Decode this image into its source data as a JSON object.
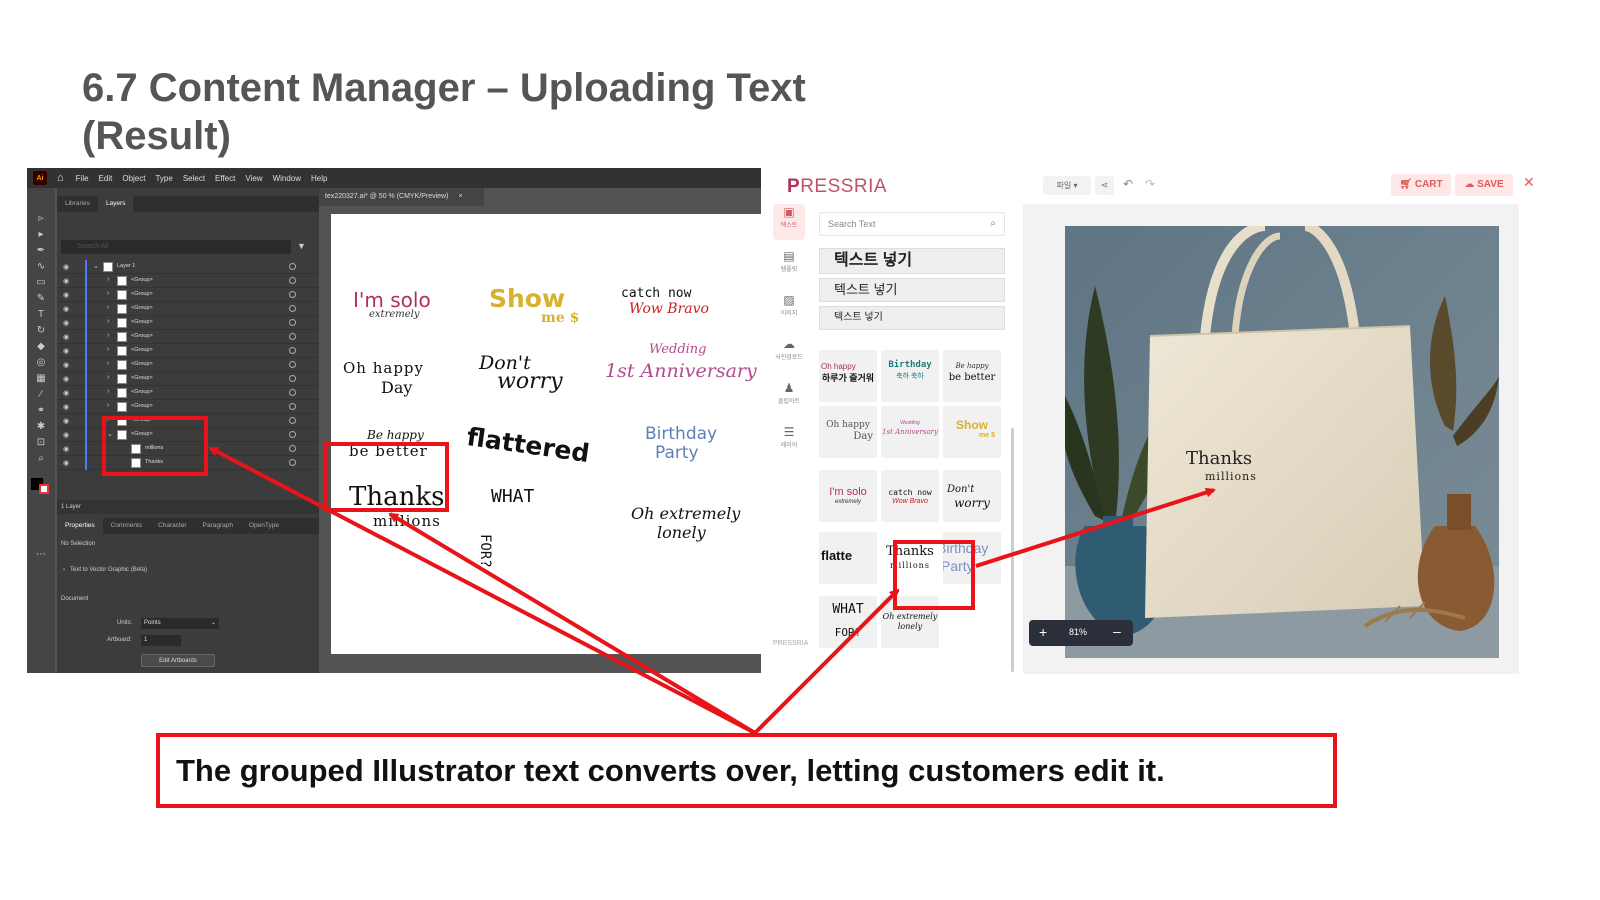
{
  "slide_title": "6.7 Content Manager – Uploading Text (Result)",
  "caption": "The grouped Illustrator text converts over, letting customers edit it.",
  "illustrator": {
    "app_icon": "Ai",
    "menu": [
      "File",
      "Edit",
      "Object",
      "Type",
      "Select",
      "Effect",
      "View",
      "Window",
      "Help"
    ],
    "panel_tabs": [
      "Libraries",
      "Layers"
    ],
    "search_placeholder": "Search All",
    "layers": {
      "top": "Layer 1",
      "group_label": "<Group>",
      "children": [
        "millions",
        "Thanks"
      ]
    },
    "layer_count": "1 Layer",
    "properties_tabs": [
      "Properties",
      "Comments",
      "Character",
      "Paragraph",
      "OpenType"
    ],
    "no_selection": "No Selection",
    "text_to_vector": "Text to Vector Graphic (Beta)",
    "document_label": "Document",
    "units_label": "Units:",
    "units_value": "Points",
    "artboard_label": "Artboard:",
    "artboard_value": "1",
    "edit_artboards": "Edit Artboards",
    "doc_tab": "tex220327.ai* @ 50 % (CMYK/Preview)",
    "artboard_items": {
      "i_m_solo": "I'm solo",
      "extremely": "extremely",
      "show": "Show",
      "me": "me $",
      "catch_now": "catch now",
      "wow_bravo": "Wow Bravo",
      "oh_happy": "Oh happy",
      "day": "Day",
      "dont": "Don't",
      "worry": "worry",
      "wedding": "Wedding",
      "anniversary": "1st Anniversary",
      "be_happy": "Be happy",
      "be_better": "be better",
      "flattered": "flattered",
      "birthday": "Birthday",
      "party": "Party",
      "thanks": "Thanks",
      "millions": "millions",
      "what": "WHAT",
      "for": "FOR?",
      "oh_extremely": "Oh extremely",
      "lonely": "lonely"
    }
  },
  "pressria": {
    "logo_p": "P",
    "logo_rest": "RESSRIA",
    "file_menu": "파일 ▾",
    "cart": "CART",
    "save": "SAVE",
    "rail": [
      "텍스트",
      "템플릿",
      "이미지",
      "사진업로드",
      "클립아트",
      "레이어"
    ],
    "brand_footer": "PRESSRIA",
    "search_placeholder": "Search Text",
    "text_buttons": [
      "텍스트 넣기",
      "텍스트 넣기",
      "텍스트 넣기"
    ],
    "tiles": {
      "t1a": "Oh happy",
      "t1b": "하루가 즐거워",
      "t2a": "Birthday",
      "t2b": "축하 축하",
      "t3a": "Be happy",
      "t3b": "be better",
      "t4a": "Oh happy",
      "t4b": "Day",
      "t5a": "Wedding",
      "t5b": "1st Anniversary",
      "t6a": "Show",
      "t6b": "me $",
      "t7a": "I'm solo",
      "t7b": "extremely",
      "t8a": "catch now",
      "t8b": "Wow Bravo",
      "t9a": "Don't",
      "t9b": "worry",
      "t10": "flatte",
      "t11a": "Thanks",
      "t11b": "millions",
      "t12a": "Birthday",
      "t12b": "Party",
      "t13a": "WHAT",
      "t13b": "FOR?",
      "t14a": "Oh extremely",
      "t14b": "lonely"
    },
    "bag_text_1": "Thanks",
    "bag_text_2": "millions",
    "zoom_plus": "+",
    "zoom_level": "81%",
    "zoom_minus": "–"
  },
  "colors": {
    "highlight_red": "#e8141a",
    "pressria_brand": "#b0315a",
    "illustrator_dark": "#535353"
  }
}
